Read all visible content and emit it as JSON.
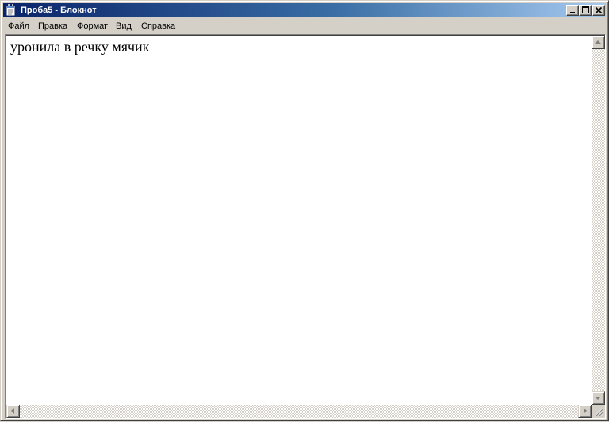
{
  "window": {
    "title": "Проба5 - Блокнот"
  },
  "icons": {
    "app": "notepad-icon",
    "minimize": "minimize-icon",
    "maximize": "maximize-icon",
    "close": "close-icon",
    "scroll_up": "arrow-up-icon",
    "scroll_down": "arrow-down-icon",
    "scroll_left": "arrow-left-icon",
    "scroll_right": "arrow-right-icon",
    "size_grip": "size-grip-icon"
  },
  "menu": {
    "items": [
      "Файл",
      "Правка",
      "Формат",
      "Вид",
      "Справка"
    ]
  },
  "document": {
    "text": "уронила в речку мячик"
  },
  "colors": {
    "titlebar_start": "#0a246a",
    "titlebar_end": "#a6caf0",
    "face": "#d4d0c8",
    "editor_bg": "#ffffff"
  }
}
